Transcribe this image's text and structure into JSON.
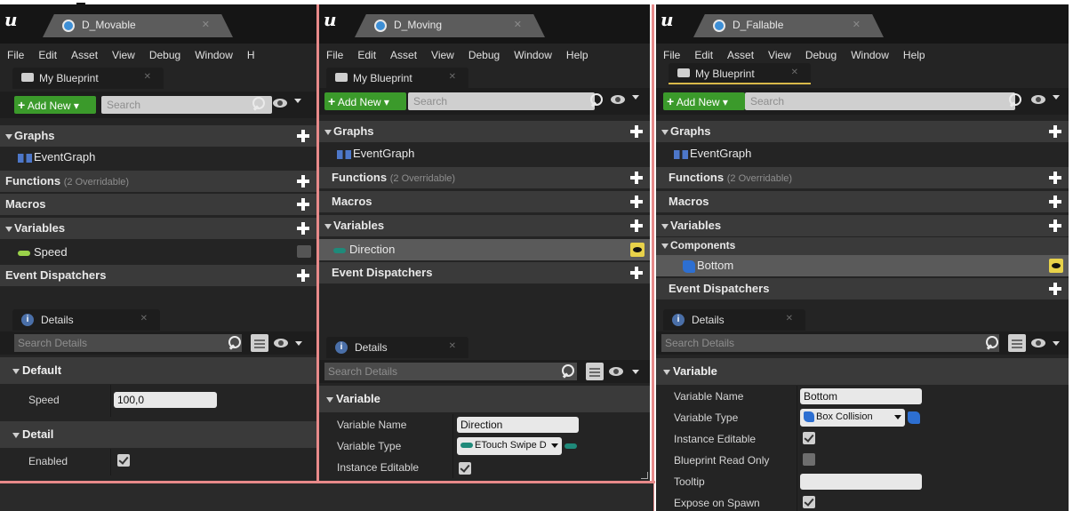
{
  "panels": [
    {
      "tab_title": "D_Movable",
      "menu": [
        "File",
        "Edit",
        "Asset",
        "View",
        "Debug",
        "Window",
        "H"
      ],
      "my_blueprint_tab": "My Blueprint",
      "add_new": "Add New",
      "search_placeholder": "Search",
      "graphs_label": "Graphs",
      "event_graph": "EventGraph",
      "functions_label": "Functions",
      "functions_sub": "(2 Overridable)",
      "macros_label": "Macros",
      "variables_label": "Variables",
      "variable_item": "Speed",
      "event_dispatchers_label": "Event Dispatchers",
      "details_tab": "Details",
      "details_search_placeholder": "Search Details",
      "cat_default": "Default",
      "prop_speed": "Speed",
      "prop_speed_value": "100,0",
      "cat_detail": "Detail",
      "prop_enabled": "Enabled"
    },
    {
      "tab_title": "D_Moving",
      "menu": [
        "File",
        "Edit",
        "Asset",
        "View",
        "Debug",
        "Window",
        "Help"
      ],
      "my_blueprint_tab": "My Blueprint",
      "add_new": "Add New",
      "search_placeholder": "Search",
      "graphs_label": "Graphs",
      "event_graph": "EventGraph",
      "functions_label": "Functions",
      "functions_sub": "(2 Overridable)",
      "macros_label": "Macros",
      "variables_label": "Variables",
      "variable_item": "Direction",
      "event_dispatchers_label": "Event Dispatchers",
      "details_tab": "Details",
      "details_search_placeholder": "Search Details",
      "cat_variable": "Variable",
      "prop_var_name": "Variable Name",
      "prop_var_name_value": "Direction",
      "prop_var_type": "Variable Type",
      "prop_var_type_value": "ETouch Swipe D",
      "prop_instance_editable": "Instance Editable"
    },
    {
      "tab_title": "D_Fallable",
      "menu": [
        "File",
        "Edit",
        "Asset",
        "View",
        "Debug",
        "Window",
        "Help"
      ],
      "my_blueprint_tab": "My Blueprint",
      "add_new": "Add New",
      "search_placeholder": "Search",
      "graphs_label": "Graphs",
      "event_graph": "EventGraph",
      "functions_label": "Functions",
      "functions_sub": "(2 Overridable)",
      "macros_label": "Macros",
      "variables_label": "Variables",
      "components_label": "Components",
      "component_item": "Bottom",
      "event_dispatchers_label": "Event Dispatchers",
      "details_tab": "Details",
      "details_search_placeholder": "Search Details",
      "cat_variable": "Variable",
      "prop_var_name": "Variable Name",
      "prop_var_name_value": "Bottom",
      "prop_var_type": "Variable Type",
      "prop_var_type_value": "Box Collision",
      "prop_instance_editable": "Instance Editable",
      "prop_bp_read_only": "Blueprint Read Only",
      "prop_tooltip": "Tooltip",
      "prop_tooltip_value": "",
      "prop_expose_on_spawn": "Expose on Spawn"
    }
  ],
  "colors": {
    "accent_green": "#3b9a2b",
    "highlight_pink": "#e88a8a",
    "speed_var": "#9ad24a",
    "direction_var": "#1f8a7a",
    "component_blue": "#2d6fd1"
  }
}
